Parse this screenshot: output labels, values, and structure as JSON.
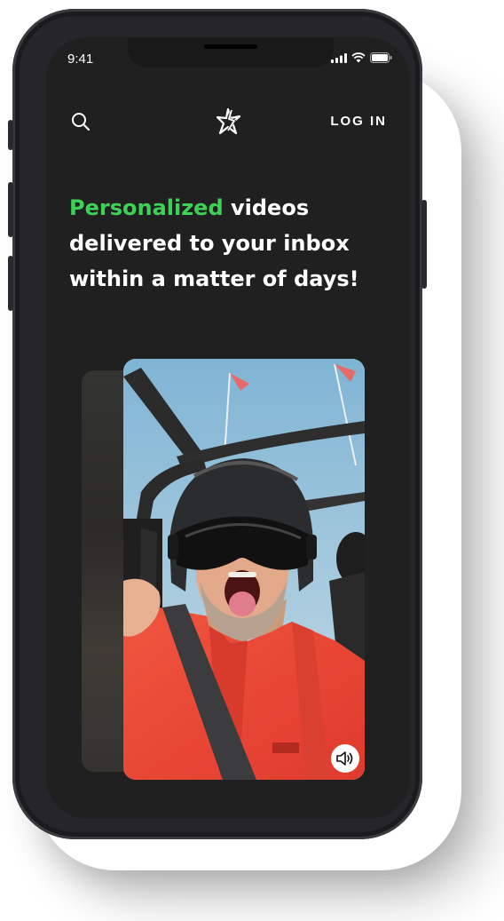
{
  "status_bar": {
    "time": "9:41"
  },
  "nav": {
    "search_icon": "search-icon",
    "logo_icon": "sparkle-star-logo",
    "login_label": "LOG IN"
  },
  "hero": {
    "accent_word": "Personalized",
    "line1_rest": " videos",
    "line2": "delivered to your inbox",
    "line3": "within a matter of days!"
  },
  "video_card": {
    "sound_icon": "speaker-sound-icon"
  },
  "colors": {
    "accent": "#3fd157",
    "screen_bg": "#202020",
    "text": "#ffffff"
  }
}
